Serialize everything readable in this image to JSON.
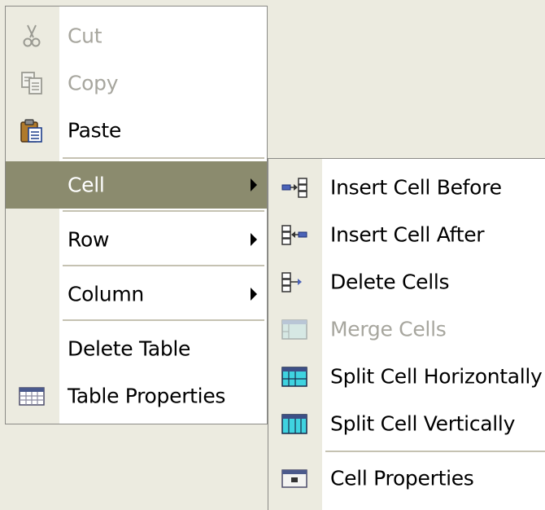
{
  "context_menu": {
    "items": [
      {
        "label": "Cut",
        "icon": "scissors-icon",
        "enabled": false
      },
      {
        "label": "Copy",
        "icon": "copy-icon",
        "enabled": false
      },
      {
        "label": "Paste",
        "icon": "paste-icon",
        "enabled": true
      },
      {
        "label": "Cell",
        "submenu": true,
        "highlighted": true
      },
      {
        "label": "Row",
        "submenu": true
      },
      {
        "label": "Column",
        "submenu": true
      },
      {
        "label": "Delete Table"
      },
      {
        "label": "Table Properties",
        "icon": "table-icon"
      }
    ]
  },
  "cell_submenu": {
    "items": [
      {
        "label": "Insert Cell Before",
        "icon": "insert-cell-before-icon"
      },
      {
        "label": "Insert Cell After",
        "icon": "insert-cell-after-icon"
      },
      {
        "label": "Delete Cells",
        "icon": "delete-cells-icon"
      },
      {
        "label": "Merge Cells",
        "icon": "merge-cells-icon",
        "enabled": false
      },
      {
        "label": "Split Cell Horizontally",
        "icon": "split-horizontal-icon"
      },
      {
        "label": "Split Cell Vertically",
        "icon": "split-vertical-icon"
      },
      {
        "label": "Cell Properties",
        "icon": "cell-properties-icon"
      }
    ]
  },
  "colors": {
    "highlight": "#8b8b6e",
    "gutter": "#ecebe0",
    "disabled_text": "#a7a69e"
  }
}
